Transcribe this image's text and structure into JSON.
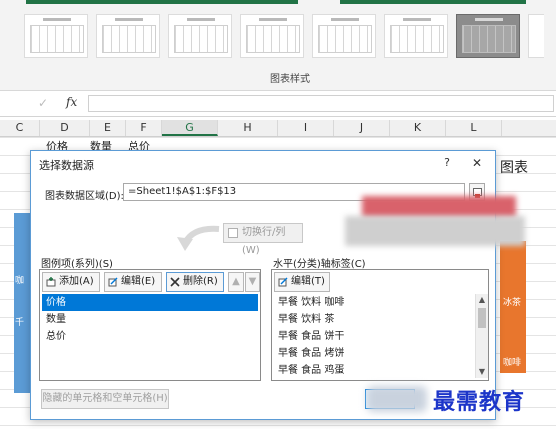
{
  "ribbon": {
    "section_label": "图表样式",
    "accent_color": "#217346"
  },
  "formula_bar": {
    "enter_icon": "check-icon",
    "fx_label": "fx",
    "value": ""
  },
  "columns": [
    "D",
    "E",
    "F",
    "G",
    "H",
    "I",
    "J",
    "K",
    "L"
  ],
  "active_column": "G",
  "sheet": {
    "header_cells": [
      "价格",
      "数量",
      "总价"
    ],
    "right_chart_title": "图表",
    "right_labels": [
      "冰茶",
      "咖啡"
    ],
    "left_labels": [
      "咖",
      "千"
    ]
  },
  "dialog": {
    "title": "选择数据源",
    "help_label": "?",
    "close_label": "✕",
    "range_label": "图表数据区域(D):",
    "range_value": "=Sheet1!$A$1:$F$13",
    "switch_label": "切换行/列(W)",
    "legend_pane": {
      "label": "图例项(系列)(S)",
      "add_label": "添加(A)",
      "edit_label": "编辑(E)",
      "delete_label": "删除(R)",
      "up_label": "▲",
      "down_label": "▼",
      "items": [
        "价格",
        "数量",
        "总价"
      ],
      "selected_index": 0
    },
    "axis_pane": {
      "label": "水平(分类)轴标签(C)",
      "edit_label": "编辑(T)",
      "items": [
        "早餐 饮料 咖啡",
        "早餐 饮料 茶",
        "早餐 食品 饼干",
        "早餐 食品 烤饼",
        "早餐 食品 鸡蛋"
      ]
    },
    "hidden_cells_label": "隐藏的单元格和空单元格(H)"
  },
  "watermark": "最需教育",
  "colors": {
    "selection": "#0078d7",
    "dialog_border": "#5b9bd5",
    "orange": "#e8762d",
    "watermark": "#1c35c9"
  }
}
